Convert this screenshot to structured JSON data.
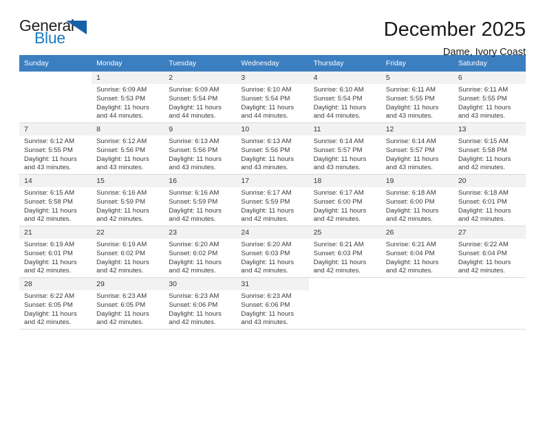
{
  "brand": {
    "name_part1": "General",
    "name_part2": "Blue",
    "triangle_color": "#1361a8",
    "blue_color": "#1a7dc4"
  },
  "header": {
    "title": "December 2025",
    "subtitle": "Dame, Ivory Coast"
  },
  "theme": {
    "header_row_bg": "#3c7fc1",
    "daynum_bg": "#f2f2f2",
    "grid_line": "#d9d9d9"
  },
  "weekday_headers": [
    "Sunday",
    "Monday",
    "Tuesday",
    "Wednesday",
    "Thursday",
    "Friday",
    "Saturday"
  ],
  "calendar_weeks": [
    [
      {
        "day": "",
        "sunrise": "",
        "sunset": "",
        "daylight_line1": "",
        "daylight_line2": ""
      },
      {
        "day": "1",
        "sunrise": "Sunrise: 6:09 AM",
        "sunset": "Sunset: 5:53 PM",
        "daylight_line1": "Daylight: 11 hours",
        "daylight_line2": "and 44 minutes."
      },
      {
        "day": "2",
        "sunrise": "Sunrise: 6:09 AM",
        "sunset": "Sunset: 5:54 PM",
        "daylight_line1": "Daylight: 11 hours",
        "daylight_line2": "and 44 minutes."
      },
      {
        "day": "3",
        "sunrise": "Sunrise: 6:10 AM",
        "sunset": "Sunset: 5:54 PM",
        "daylight_line1": "Daylight: 11 hours",
        "daylight_line2": "and 44 minutes."
      },
      {
        "day": "4",
        "sunrise": "Sunrise: 6:10 AM",
        "sunset": "Sunset: 5:54 PM",
        "daylight_line1": "Daylight: 11 hours",
        "daylight_line2": "and 44 minutes."
      },
      {
        "day": "5",
        "sunrise": "Sunrise: 6:11 AM",
        "sunset": "Sunset: 5:55 PM",
        "daylight_line1": "Daylight: 11 hours",
        "daylight_line2": "and 43 minutes."
      },
      {
        "day": "6",
        "sunrise": "Sunrise: 6:11 AM",
        "sunset": "Sunset: 5:55 PM",
        "daylight_line1": "Daylight: 11 hours",
        "daylight_line2": "and 43 minutes."
      }
    ],
    [
      {
        "day": "7",
        "sunrise": "Sunrise: 6:12 AM",
        "sunset": "Sunset: 5:55 PM",
        "daylight_line1": "Daylight: 11 hours",
        "daylight_line2": "and 43 minutes."
      },
      {
        "day": "8",
        "sunrise": "Sunrise: 6:12 AM",
        "sunset": "Sunset: 5:56 PM",
        "daylight_line1": "Daylight: 11 hours",
        "daylight_line2": "and 43 minutes."
      },
      {
        "day": "9",
        "sunrise": "Sunrise: 6:13 AM",
        "sunset": "Sunset: 5:56 PM",
        "daylight_line1": "Daylight: 11 hours",
        "daylight_line2": "and 43 minutes."
      },
      {
        "day": "10",
        "sunrise": "Sunrise: 6:13 AM",
        "sunset": "Sunset: 5:56 PM",
        "daylight_line1": "Daylight: 11 hours",
        "daylight_line2": "and 43 minutes."
      },
      {
        "day": "11",
        "sunrise": "Sunrise: 6:14 AM",
        "sunset": "Sunset: 5:57 PM",
        "daylight_line1": "Daylight: 11 hours",
        "daylight_line2": "and 43 minutes."
      },
      {
        "day": "12",
        "sunrise": "Sunrise: 6:14 AM",
        "sunset": "Sunset: 5:57 PM",
        "daylight_line1": "Daylight: 11 hours",
        "daylight_line2": "and 43 minutes."
      },
      {
        "day": "13",
        "sunrise": "Sunrise: 6:15 AM",
        "sunset": "Sunset: 5:58 PM",
        "daylight_line1": "Daylight: 11 hours",
        "daylight_line2": "and 42 minutes."
      }
    ],
    [
      {
        "day": "14",
        "sunrise": "Sunrise: 6:15 AM",
        "sunset": "Sunset: 5:58 PM",
        "daylight_line1": "Daylight: 11 hours",
        "daylight_line2": "and 42 minutes."
      },
      {
        "day": "15",
        "sunrise": "Sunrise: 6:16 AM",
        "sunset": "Sunset: 5:59 PM",
        "daylight_line1": "Daylight: 11 hours",
        "daylight_line2": "and 42 minutes."
      },
      {
        "day": "16",
        "sunrise": "Sunrise: 6:16 AM",
        "sunset": "Sunset: 5:59 PM",
        "daylight_line1": "Daylight: 11 hours",
        "daylight_line2": "and 42 minutes."
      },
      {
        "day": "17",
        "sunrise": "Sunrise: 6:17 AM",
        "sunset": "Sunset: 5:59 PM",
        "daylight_line1": "Daylight: 11 hours",
        "daylight_line2": "and 42 minutes."
      },
      {
        "day": "18",
        "sunrise": "Sunrise: 6:17 AM",
        "sunset": "Sunset: 6:00 PM",
        "daylight_line1": "Daylight: 11 hours",
        "daylight_line2": "and 42 minutes."
      },
      {
        "day": "19",
        "sunrise": "Sunrise: 6:18 AM",
        "sunset": "Sunset: 6:00 PM",
        "daylight_line1": "Daylight: 11 hours",
        "daylight_line2": "and 42 minutes."
      },
      {
        "day": "20",
        "sunrise": "Sunrise: 6:18 AM",
        "sunset": "Sunset: 6:01 PM",
        "daylight_line1": "Daylight: 11 hours",
        "daylight_line2": "and 42 minutes."
      }
    ],
    [
      {
        "day": "21",
        "sunrise": "Sunrise: 6:19 AM",
        "sunset": "Sunset: 6:01 PM",
        "daylight_line1": "Daylight: 11 hours",
        "daylight_line2": "and 42 minutes."
      },
      {
        "day": "22",
        "sunrise": "Sunrise: 6:19 AM",
        "sunset": "Sunset: 6:02 PM",
        "daylight_line1": "Daylight: 11 hours",
        "daylight_line2": "and 42 minutes."
      },
      {
        "day": "23",
        "sunrise": "Sunrise: 6:20 AM",
        "sunset": "Sunset: 6:02 PM",
        "daylight_line1": "Daylight: 11 hours",
        "daylight_line2": "and 42 minutes."
      },
      {
        "day": "24",
        "sunrise": "Sunrise: 6:20 AM",
        "sunset": "Sunset: 6:03 PM",
        "daylight_line1": "Daylight: 11 hours",
        "daylight_line2": "and 42 minutes."
      },
      {
        "day": "25",
        "sunrise": "Sunrise: 6:21 AM",
        "sunset": "Sunset: 6:03 PM",
        "daylight_line1": "Daylight: 11 hours",
        "daylight_line2": "and 42 minutes."
      },
      {
        "day": "26",
        "sunrise": "Sunrise: 6:21 AM",
        "sunset": "Sunset: 6:04 PM",
        "daylight_line1": "Daylight: 11 hours",
        "daylight_line2": "and 42 minutes."
      },
      {
        "day": "27",
        "sunrise": "Sunrise: 6:22 AM",
        "sunset": "Sunset: 6:04 PM",
        "daylight_line1": "Daylight: 11 hours",
        "daylight_line2": "and 42 minutes."
      }
    ],
    [
      {
        "day": "28",
        "sunrise": "Sunrise: 6:22 AM",
        "sunset": "Sunset: 6:05 PM",
        "daylight_line1": "Daylight: 11 hours",
        "daylight_line2": "and 42 minutes."
      },
      {
        "day": "29",
        "sunrise": "Sunrise: 6:23 AM",
        "sunset": "Sunset: 6:05 PM",
        "daylight_line1": "Daylight: 11 hours",
        "daylight_line2": "and 42 minutes."
      },
      {
        "day": "30",
        "sunrise": "Sunrise: 6:23 AM",
        "sunset": "Sunset: 6:06 PM",
        "daylight_line1": "Daylight: 11 hours",
        "daylight_line2": "and 42 minutes."
      },
      {
        "day": "31",
        "sunrise": "Sunrise: 6:23 AM",
        "sunset": "Sunset: 6:06 PM",
        "daylight_line1": "Daylight: 11 hours",
        "daylight_line2": "and 43 minutes."
      },
      {
        "day": "",
        "sunrise": "",
        "sunset": "",
        "daylight_line1": "",
        "daylight_line2": ""
      },
      {
        "day": "",
        "sunrise": "",
        "sunset": "",
        "daylight_line1": "",
        "daylight_line2": ""
      },
      {
        "day": "",
        "sunrise": "",
        "sunset": "",
        "daylight_line1": "",
        "daylight_line2": ""
      }
    ]
  ]
}
